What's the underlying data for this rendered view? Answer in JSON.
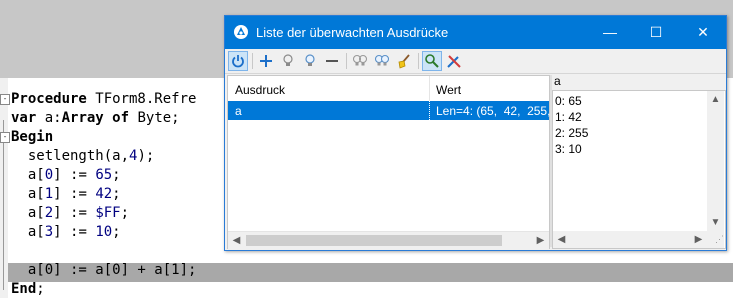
{
  "editor": {
    "lines": [
      {
        "parts": [
          {
            "t": "Procedure",
            "c": "kw"
          },
          {
            "t": " TForm8.Refre",
            "c": ""
          }
        ]
      },
      {
        "parts": [
          {
            "t": "var",
            "c": "kw"
          },
          {
            "t": " a:",
            "c": ""
          },
          {
            "t": "Array of",
            "c": "kw"
          },
          {
            "t": " Byte;",
            "c": ""
          }
        ]
      },
      {
        "parts": [
          {
            "t": "Begin",
            "c": "kw"
          }
        ]
      },
      {
        "parts": [
          {
            "t": "  setlength(a,",
            "c": ""
          },
          {
            "t": "4",
            "c": "num"
          },
          {
            "t": ");",
            "c": ""
          }
        ]
      },
      {
        "parts": [
          {
            "t": "  a[",
            "c": ""
          },
          {
            "t": "0",
            "c": "num"
          },
          {
            "t": "] := ",
            "c": ""
          },
          {
            "t": "65",
            "c": "num"
          },
          {
            "t": ";",
            "c": ""
          }
        ]
      },
      {
        "parts": [
          {
            "t": "  a[",
            "c": ""
          },
          {
            "t": "1",
            "c": "num"
          },
          {
            "t": "] := ",
            "c": ""
          },
          {
            "t": "42",
            "c": "num"
          },
          {
            "t": ";",
            "c": ""
          }
        ]
      },
      {
        "parts": [
          {
            "t": "  a[",
            "c": ""
          },
          {
            "t": "2",
            "c": "num"
          },
          {
            "t": "] := ",
            "c": ""
          },
          {
            "t": "$FF",
            "c": "num"
          },
          {
            "t": ";",
            "c": ""
          }
        ]
      },
      {
        "parts": [
          {
            "t": "  a[",
            "c": ""
          },
          {
            "t": "3",
            "c": "num"
          },
          {
            "t": "] := ",
            "c": ""
          },
          {
            "t": "10",
            "c": "num"
          },
          {
            "t": ";",
            "c": ""
          }
        ]
      },
      {
        "parts": [
          {
            "t": "",
            "c": ""
          }
        ]
      },
      {
        "parts": [
          {
            "t": "  a[0] := a[0] + a[1];",
            "c": ""
          }
        ]
      },
      {
        "parts": [
          {
            "t": "End",
            "c": "kw"
          },
          {
            "t": ";",
            "c": ""
          }
        ]
      }
    ]
  },
  "window": {
    "title": "Liste der überwachten Ausdrücke",
    "controls": {
      "minimize": "—",
      "maximize": "☐",
      "close": "✕"
    },
    "toolbar_icons": [
      "power-icon",
      "add-icon",
      "lightbulb-off-icon",
      "lightbulb-on-icon",
      "remove-icon",
      "group-off-icon",
      "group-on-icon",
      "broom-icon",
      "inspect-icon",
      "tools-icon"
    ],
    "list": {
      "columns": [
        "Ausdruck",
        "Wert"
      ],
      "rows": [
        {
          "expr": "a",
          "value": "Len=4: (65,  42,  255,"
        }
      ]
    },
    "detail": {
      "label": "a",
      "items": [
        "0: 65",
        "1: 42",
        "2: 255",
        "3: 10"
      ]
    }
  },
  "colors": {
    "title_bar": "#0078d7",
    "selection": "#0078d7",
    "editor_highlight": "#a8a8a8"
  }
}
